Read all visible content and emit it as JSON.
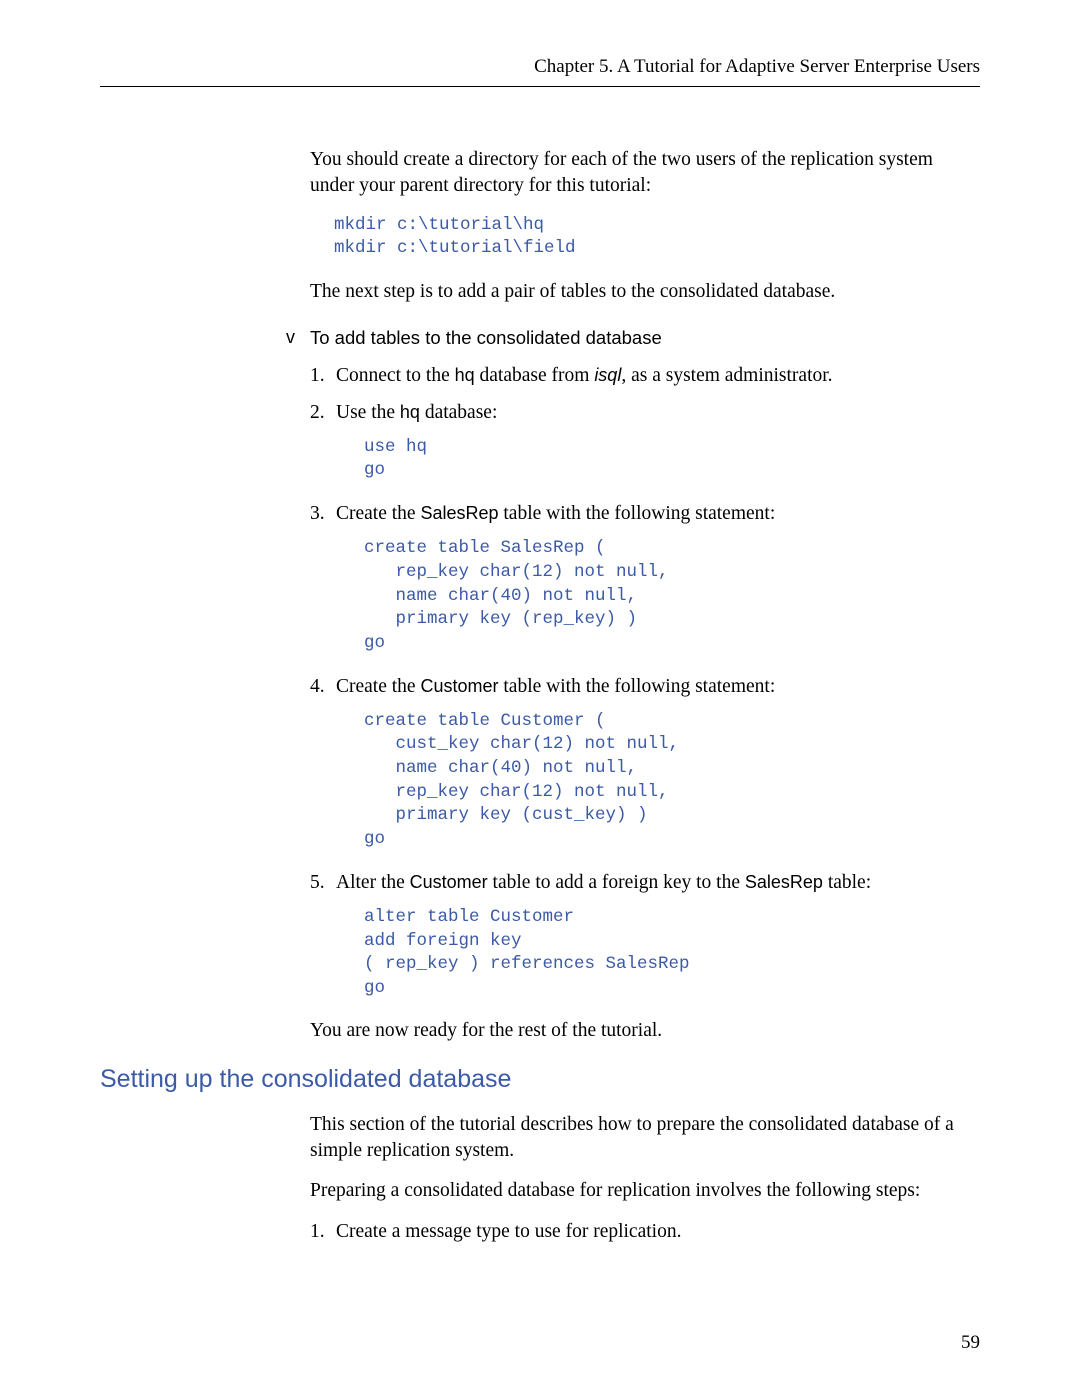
{
  "header": "Chapter 5.  A Tutorial for Adaptive Server Enterprise Users",
  "intro_para": "You should create a directory for each of the two users of the replication system under your parent directory for this tutorial:",
  "code_mkdir": "mkdir c:\\tutorial\\hq\nmkdir c:\\tutorial\\field",
  "after_mkdir": "The next step is to add a pair of tables to the consolidated database.",
  "proc_bullet": "v",
  "proc_title": "To add tables to the consolidated database",
  "steps": {
    "s1_num": "1.",
    "s1_a": "Connect to the ",
    "s1_b": "hq",
    "s1_c": " database from ",
    "s1_d": "isql",
    "s1_e": ", as a system administrator.",
    "s2_num": "2.",
    "s2_a": "Use the ",
    "s2_b": "hq",
    "s2_c": " database:",
    "s2_code": "use hq\ngo",
    "s3_num": "3.",
    "s3_a": "Create the ",
    "s3_b": "SalesRep",
    "s3_c": " table with the following statement:",
    "s3_code": "create table SalesRep (\n   rep_key char(12) not null,\n   name char(40) not null,\n   primary key (rep_key) )\ngo",
    "s4_num": "4.",
    "s4_a": "Create the ",
    "s4_b": "Customer",
    "s4_c": " table with the following statement:",
    "s4_code": "create table Customer (\n   cust_key char(12) not null,\n   name char(40) not null,\n   rep_key char(12) not null,\n   primary key (cust_key) )\ngo",
    "s5_num": "5.",
    "s5_a": "Alter the ",
    "s5_b": "Customer",
    "s5_c": " table to add a foreign key to the ",
    "s5_d": "SalesRep",
    "s5_e": " table:",
    "s5_code": "alter table Customer\nadd foreign key\n( rep_key ) references SalesRep\ngo"
  },
  "closing_para": "You are now ready for the rest of the tutorial.",
  "section_heading": "Setting up the consolidated database",
  "sec_para1": "This section of the tutorial describes how to prepare the consolidated database of a simple replication system.",
  "sec_para2": "Preparing a consolidated database for replication involves the following steps:",
  "sec_step1_num": "1.",
  "sec_step1_text": "Create a message type to use for replication.",
  "page_num": "59"
}
